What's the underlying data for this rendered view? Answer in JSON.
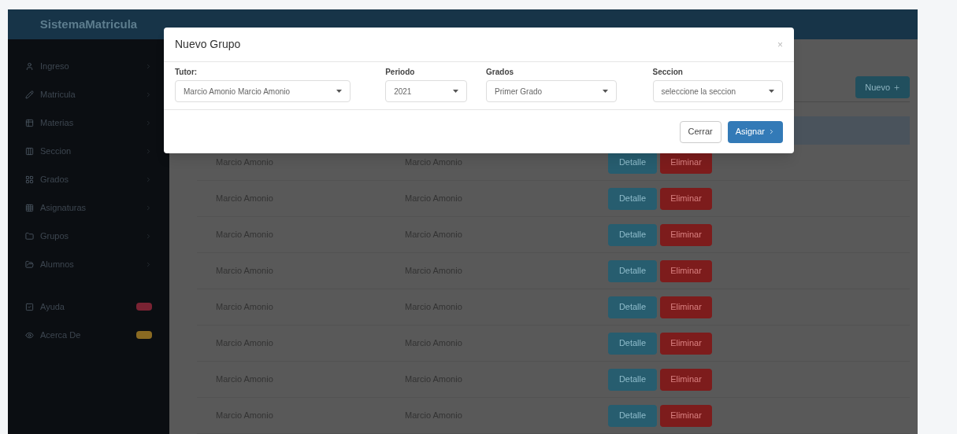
{
  "header": {
    "brand": "SistemaMatricula"
  },
  "sidebar": {
    "items": [
      {
        "label": "Ingreso"
      },
      {
        "label": "Matricula"
      },
      {
        "label": "Materias"
      },
      {
        "label": "Seccion"
      },
      {
        "label": "Grados"
      },
      {
        "label": "Asignaturas"
      },
      {
        "label": "Grupos"
      },
      {
        "label": "Alumnos"
      }
    ],
    "extras": [
      {
        "label": "Ayuda",
        "color": "#7a2333"
      },
      {
        "label": "Acerca De",
        "color": "#8a6a22"
      }
    ]
  },
  "main": {
    "new_button": "Nuevo",
    "rows": [
      {
        "tutor": "Marcio Amonio",
        "name": "Marcio Amonio",
        "detail": "Detalle",
        "delete": "Eliminar"
      },
      {
        "tutor": "Marcio Amonio",
        "name": "Marcio Amonio",
        "detail": "Detalle",
        "delete": "Eliminar"
      },
      {
        "tutor": "Marcio Amonio",
        "name": "Marcio Amonio",
        "detail": "Detalle",
        "delete": "Eliminar"
      },
      {
        "tutor": "Marcio Amonio",
        "name": "Marcio Amonio",
        "detail": "Detalle",
        "delete": "Eliminar"
      },
      {
        "tutor": "Marcio Amonio",
        "name": "Marcio Amonio",
        "detail": "Detalle",
        "delete": "Eliminar"
      },
      {
        "tutor": "Marcio Amonio",
        "name": "Marcio Amonio",
        "detail": "Detalle",
        "delete": "Eliminar"
      },
      {
        "tutor": "Marcio Amonio",
        "name": "Marcio Amonio",
        "detail": "Detalle",
        "delete": "Eliminar"
      },
      {
        "tutor": "Marcio Amonio",
        "name": "Marcio Amonio",
        "detail": "Detalle",
        "delete": "Eliminar"
      }
    ]
  },
  "modal": {
    "title": "Nuevo Grupo",
    "close": "×",
    "fields": [
      {
        "label": "Tutor:",
        "value": "Marcio Amonio Marcio Amonio"
      },
      {
        "label": "Periodo",
        "value": "2021"
      },
      {
        "label": "Grados",
        "value": "Primer Grado"
      },
      {
        "label": "Seccion",
        "value": "seleccione la seccion"
      }
    ],
    "cancel": "Cerrar",
    "submit": "Asignar"
  }
}
